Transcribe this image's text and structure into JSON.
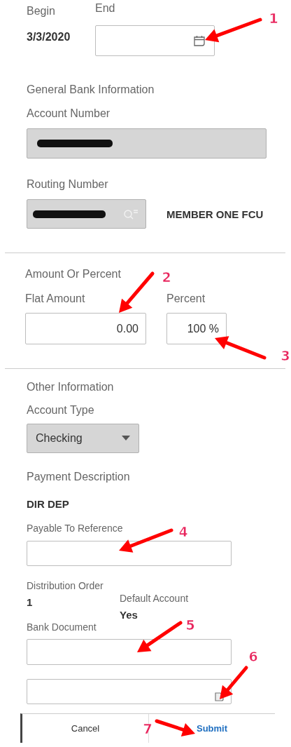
{
  "date_range": {
    "begin": {
      "label": "Begin",
      "value": "3/3/2020"
    },
    "end": {
      "label": "End"
    }
  },
  "general_bank": {
    "heading": "General Bank Information",
    "account_number": {
      "label": "Account Number",
      "redacted": true
    },
    "routing_number": {
      "label": "Routing Number",
      "redacted": true
    },
    "bank_name": "MEMBER ONE FCU"
  },
  "amount_or_percent": {
    "heading": "Amount Or Percent",
    "flat_amount": {
      "label": "Flat Amount",
      "value": "0.00"
    },
    "percent": {
      "label": "Percent",
      "value": "100 %"
    }
  },
  "other": {
    "heading": "Other Information",
    "account_type": {
      "label": "Account Type",
      "value": "Checking"
    },
    "payment_description": {
      "label": "Payment Description",
      "value": "DIR DEP"
    },
    "payable_to_reference": {
      "label": "Payable To Reference"
    },
    "distribution_order": {
      "label": "Distribution Order",
      "value": "1"
    },
    "default_account": {
      "label": "Default Account",
      "value": "Yes"
    },
    "bank_document": {
      "label": "Bank Document"
    }
  },
  "buttons": [
    {
      "label": "Cancel",
      "kind": "secondary"
    },
    {
      "label": "Submit",
      "kind": "primary"
    }
  ],
  "callouts": [
    {
      "number": "1"
    },
    {
      "number": "2"
    },
    {
      "number": "3"
    },
    {
      "number": "4"
    },
    {
      "number": "5"
    },
    {
      "number": "6"
    },
    {
      "number": "7"
    }
  ]
}
